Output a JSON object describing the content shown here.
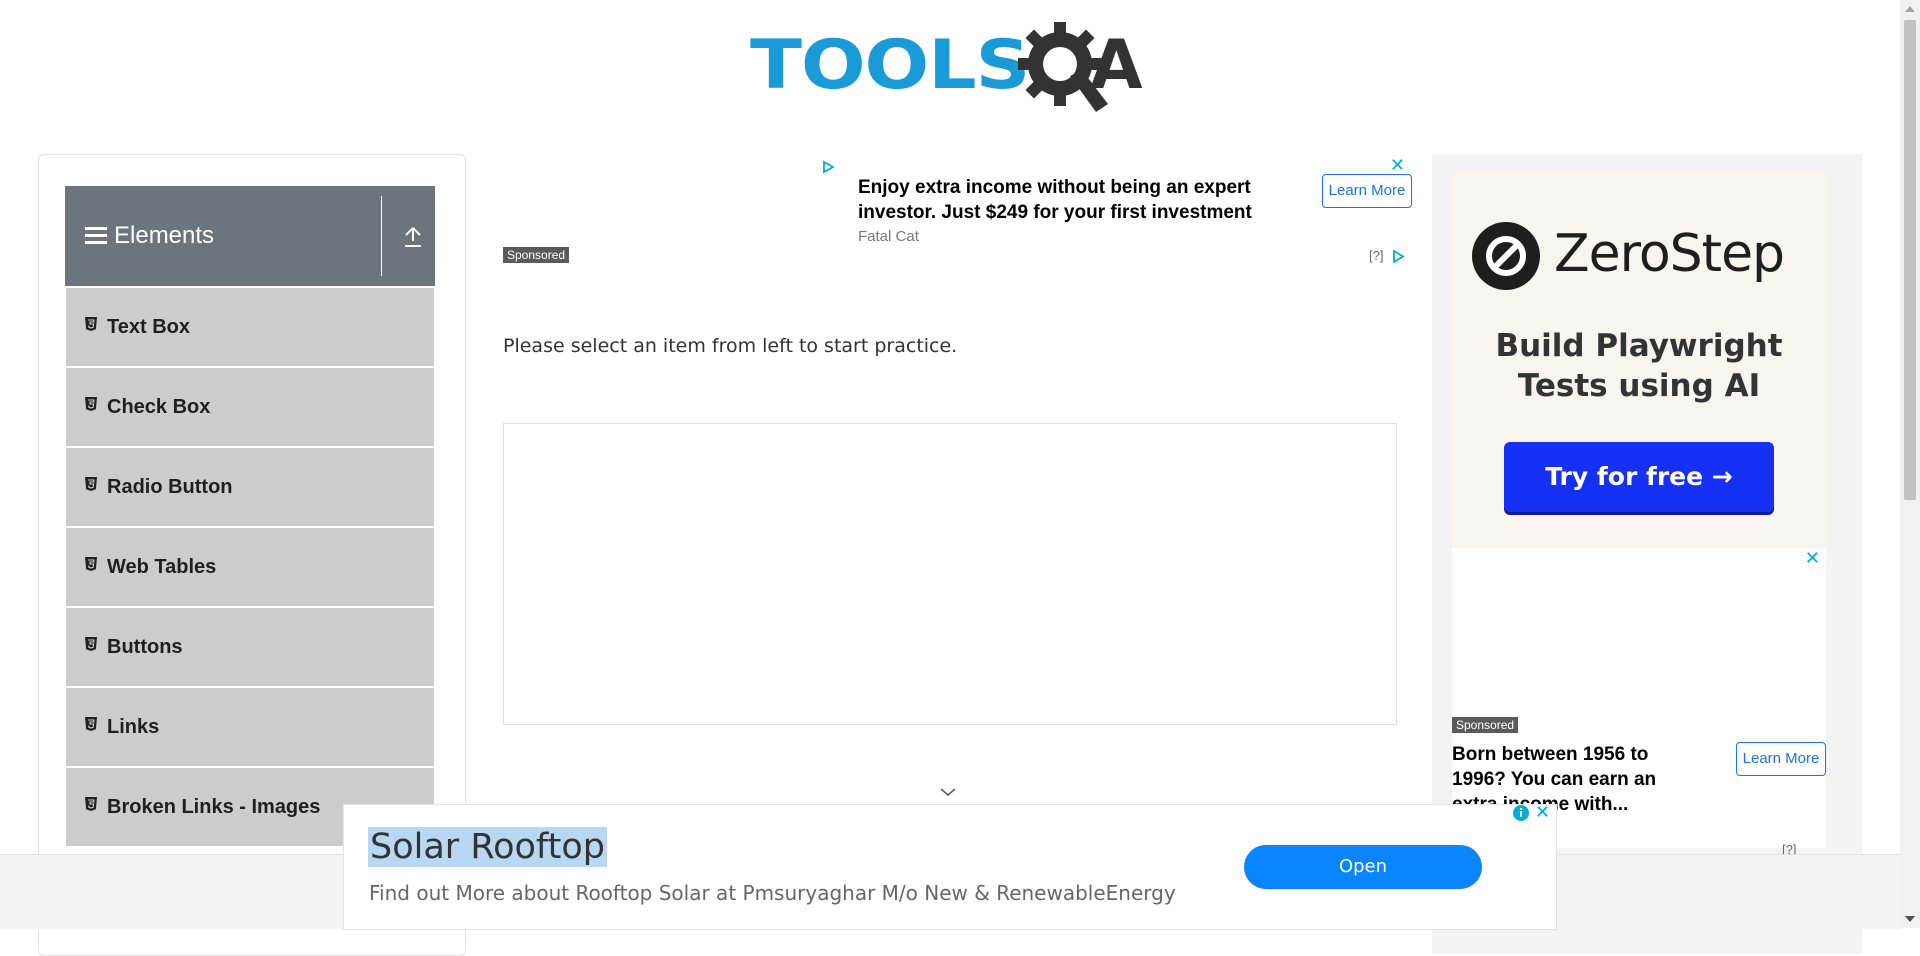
{
  "logo": {
    "text_part": "TOOLS",
    "q_part": "Q",
    "a_part": "A"
  },
  "sidebar": {
    "group_title": "Elements",
    "items": [
      {
        "label": "Text Box"
      },
      {
        "label": "Check Box"
      },
      {
        "label": "Radio Button"
      },
      {
        "label": "Web Tables"
      },
      {
        "label": "Buttons"
      },
      {
        "label": "Links"
      },
      {
        "label": "Broken Links - Images"
      }
    ]
  },
  "top_ad": {
    "headline": "Enjoy extra income without being an expert investor. Just $249 for your first investment",
    "advertiser": "Fatal Cat",
    "cta": "Learn More",
    "sponsored": "Sponsored",
    "help": "[?]",
    "close": "✕"
  },
  "main": {
    "instruction": "Please select an item from left to start practice."
  },
  "right_ad": {
    "brand": "ZeroStep",
    "tagline": "Build Playwright Tests using AI",
    "cta": "Try for free →"
  },
  "right_ad2": {
    "sponsored": "Sponsored",
    "headline": "Born between 1956 to 1996? You can earn an extra income with...",
    "cta": "Learn More",
    "help": "[?]",
    "close": "✕"
  },
  "sticky_ad": {
    "title": "Solar Rooftop",
    "description": "Find out More about Rooftop Solar at Pmsuryaghar M/o New & RenewableEnergy",
    "cta": "Open",
    "close": "✕"
  },
  "colors": {
    "brand_blue": "#1a9bd7",
    "header_gray": "#6c757d",
    "menu_gray": "#cccccc",
    "cta_blue": "#1730f5",
    "open_blue": "#0a84ff"
  }
}
